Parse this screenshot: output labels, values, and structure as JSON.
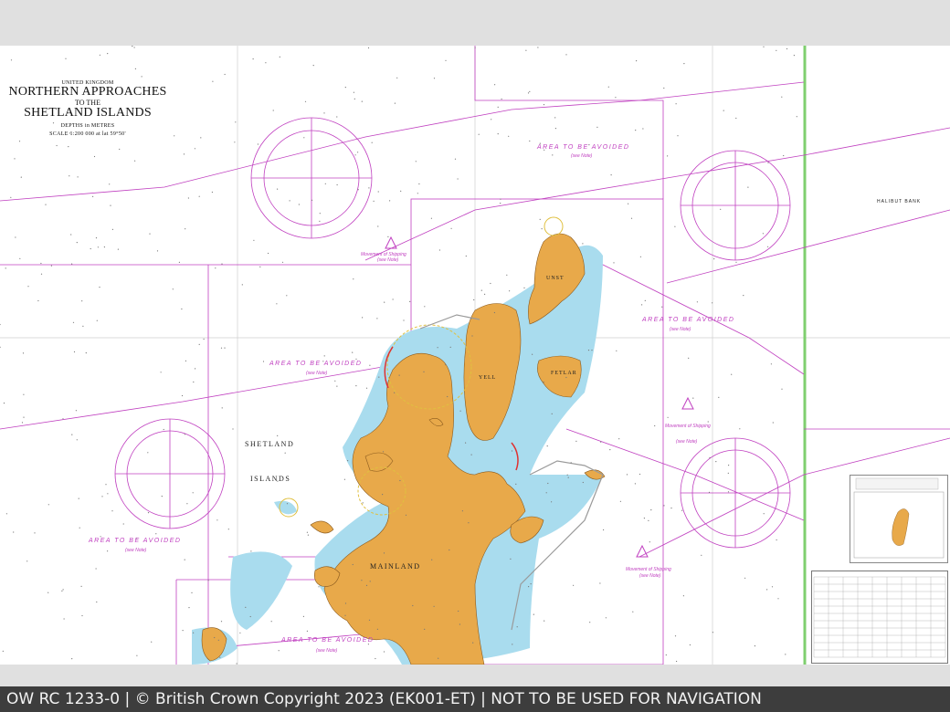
{
  "footer": {
    "text": "OW RC 1233-0 | © British Crown Copyright 2023 (EK001-ET) | NOT TO BE USED FOR NAVIGATION"
  },
  "title_block": {
    "country": "UNITED KINGDOM",
    "title_line1": "NORTHERN APPROACHES",
    "title_line2": "TO THE",
    "title_line3": "SHETLAND ISLANDS",
    "depths": "DEPTHS in METRES",
    "scale": "SCALE 1:200 000 at lat 59°50'"
  },
  "labels": {
    "area_avoided": "AREA TO BE AVOIDED",
    "see_note": "(see Note)",
    "movement_shipping": "Movement of Shipping",
    "shetland": "SHETLAND",
    "islands": "ISLANDS",
    "mainland": "MAINLAND",
    "yell": "YELL",
    "unst": "UNST",
    "fetlar": "FETLAR",
    "halibut_bank": "HALIBUT BANK"
  },
  "colors": {
    "land": "#e8a94a",
    "shallow_water": "#a9dcee",
    "magenta": "#c040c0",
    "grid": "#c9c9c9",
    "footer_bg": "#3d3d3d",
    "green_border": "#7fcf6f"
  }
}
